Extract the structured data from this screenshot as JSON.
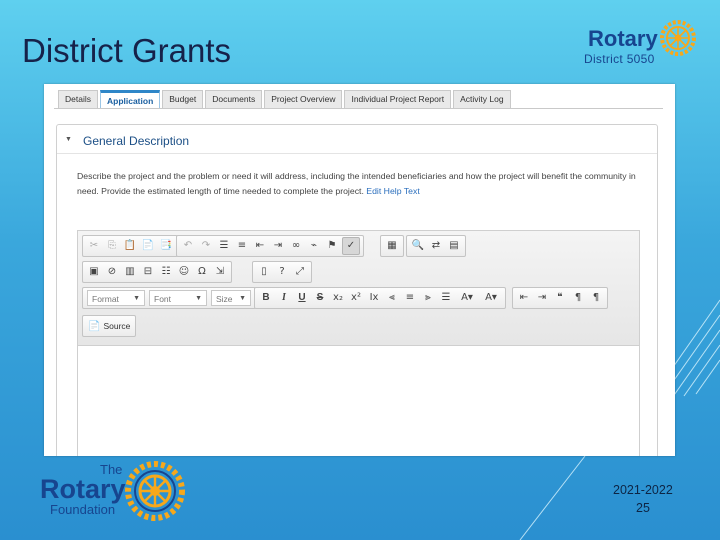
{
  "slide": {
    "title": "District Grants",
    "logo_top": {
      "wordmark": "Rotary",
      "district": "District 5050"
    },
    "logo_bottom": {
      "the": "The",
      "wordmark": "Rotary",
      "foundation": "Foundation"
    },
    "footer": {
      "year": "2021-2022",
      "page": "25"
    }
  },
  "app": {
    "tabs": [
      {
        "label": "Details",
        "active": false
      },
      {
        "label": "Application",
        "active": true
      },
      {
        "label": "Budget",
        "active": false
      },
      {
        "label": "Documents",
        "active": false
      },
      {
        "label": "Project Overview",
        "active": false
      },
      {
        "label": "Individual Project Report",
        "active": false
      },
      {
        "label": "Activity Log",
        "active": false
      }
    ],
    "section": {
      "title": "General Description",
      "description": "Describe the project and the problem or need it will address, including the intended beneficiaries and how the project will benefit the community in need. Provide the estimated length of time needed to complete the project.",
      "edit_link": "Edit Help Text"
    },
    "editor": {
      "format_placeholder": "Format",
      "font_placeholder": "Font",
      "size_placeholder": "Size",
      "source_label": "Source"
    }
  },
  "colors": {
    "accent": "#2e86c8",
    "rotary_blue": "#17458f",
    "rotary_gold": "#f7a81b"
  }
}
